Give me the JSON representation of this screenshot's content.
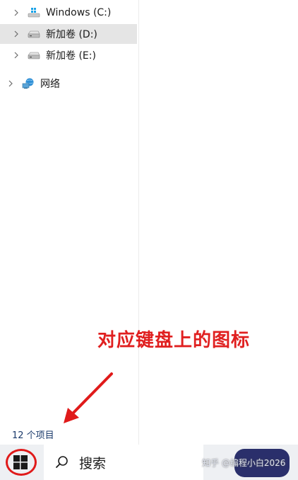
{
  "nav": {
    "items": [
      {
        "label": "Windows (C:)",
        "icon": "windows-drive-icon",
        "selected": false
      },
      {
        "label": "新加卷 (D:)",
        "icon": "drive-icon",
        "selected": true
      },
      {
        "label": "新加卷 (E:)",
        "icon": "drive-icon",
        "selected": false
      },
      {
        "label": "网络",
        "icon": "network-icon",
        "selected": false
      }
    ]
  },
  "status": {
    "item_count": "12 个项目"
  },
  "annotation": {
    "text": "对应键盘上的图标",
    "color": "#e02020"
  },
  "taskbar": {
    "search_label": "搜索",
    "start_icon": "windows-logo-icon",
    "watermark": "知乎 @编程小白2026"
  },
  "colors": {
    "accent_red": "#e01a1a",
    "selection": "#e5e5e5",
    "windows_blue": "#0078d4"
  }
}
